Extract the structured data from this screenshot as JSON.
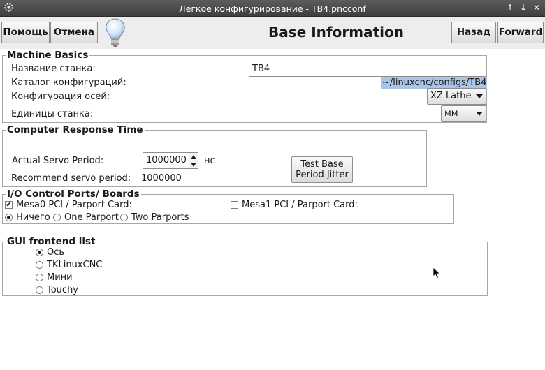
{
  "window": {
    "title": "Легкое конфигурирование - TB4.pncconf",
    "controls": [
      "↑",
      "↓",
      "✕"
    ]
  },
  "toolbar": {
    "help_label": "Помощь",
    "cancel_label": "Отмена",
    "page_title": "Base Information",
    "back_label": "Назад",
    "forward_label": "Forward"
  },
  "machine_basics": {
    "title": "Machine Basics",
    "name_label": "Название станка:",
    "name_value": "TB4",
    "dir_label": "Каталог конфигураций:",
    "dir_value": "~/linuxcnc/configs/TB4",
    "axis_label": "Конфигурация осей:",
    "axis_value": "XZ Lathe",
    "units_label": "Единицы станка:",
    "units_value": "мм"
  },
  "response_time": {
    "title": "Computer Response Time",
    "servo_label": "Actual Servo Period:",
    "servo_value": "1000000",
    "servo_unit": "нс",
    "recommend_label": "Recommend servo period:",
    "recommend_value": "1000000",
    "test_button_line1": "Test Base",
    "test_button_line2": "Period Jitter"
  },
  "io_ports": {
    "title": "I/O Control Ports/ Boards",
    "mesa0_label": "Mesa0 PCI / Parport Card:",
    "mesa0_checked": true,
    "mesa1_label": "Mesa1 PCI / Parport Card:",
    "mesa1_checked": false,
    "parport_options": [
      "Ничего",
      "One Parport",
      "Two Parports"
    ],
    "parport_selected": "Ничего"
  },
  "gui_frontend": {
    "title": "GUI frontend list",
    "options": [
      "Ось",
      "TKLinuxCNC",
      "Мини",
      "Touchy"
    ],
    "selected": "Ось"
  },
  "colors": {
    "titlebar": "#4a4a4a",
    "toolbar": "#ededed",
    "selection": "#a8c4e6"
  },
  "icons": {
    "title_app": "gear-icon",
    "hint": "lightbulb-icon"
  }
}
